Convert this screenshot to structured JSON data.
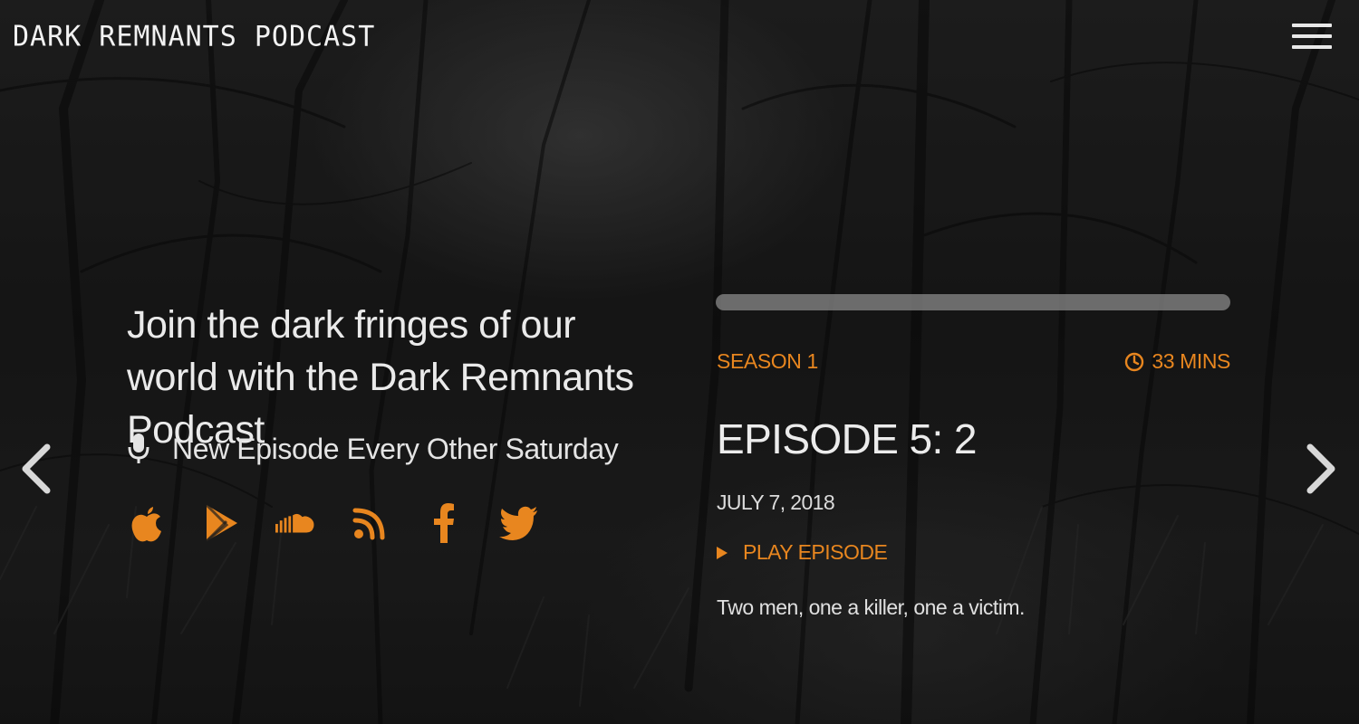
{
  "header": {
    "logo_text": "DARK REMNANTS PODCAST",
    "menu_icon": "hamburger-menu-icon"
  },
  "hero": {
    "tagline": "Join the dark fringes of our world with the Dark Remnants Podcast",
    "schedule_icon": "microphone-icon",
    "schedule_text": "New Episode Every Other Saturday",
    "social_icons": [
      "apple-icon",
      "google-play-icon",
      "soundcloud-icon",
      "rss-icon",
      "facebook-icon",
      "twitter-icon"
    ]
  },
  "episode": {
    "progress": 0.0,
    "season": "SEASON 1",
    "duration": "33 MINS",
    "duration_icon": "clock-icon",
    "title": "EPISODE 5: 2",
    "date": "JULY 7, 2018",
    "play_label": "PLAY EPISODE",
    "play_icon": "play-triangle-icon",
    "description": "Two men, one a killer, one a victim."
  },
  "navigation": {
    "prev_icon": "chevron-left-icon",
    "next_icon": "chevron-right-icon"
  },
  "colors": {
    "accent": "#e8861f",
    "text": "#ececec",
    "background": "#1b1b1b"
  }
}
